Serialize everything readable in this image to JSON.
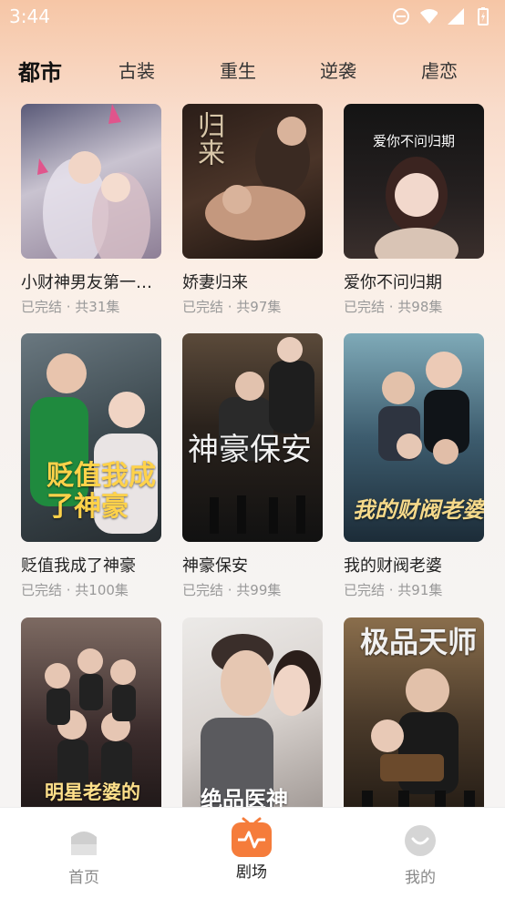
{
  "status": {
    "time": "3:44"
  },
  "tabs": [
    "都市",
    "古装",
    "重生",
    "逆袭",
    "虐恋"
  ],
  "items": [
    {
      "title": "小财神男友第一…",
      "meta": "已完结 · 共31集"
    },
    {
      "title": "娇妻归来",
      "meta": "已完结 · 共97集",
      "poster_text": "归来"
    },
    {
      "title": "爱你不问归期",
      "meta": "已完结 · 共98集",
      "poster_text": "爱你不问归期"
    },
    {
      "title": "贬值我成了神豪",
      "meta": "已完结 · 共100集",
      "poster_text": "贬值我成了神豪"
    },
    {
      "title": "神豪保安",
      "meta": "已完结 · 共99集",
      "poster_text": "神豪保安"
    },
    {
      "title": "我的财阀老婆",
      "meta": "已完结 · 共91集",
      "poster_text": "我的财阀老婆"
    },
    {
      "title": "",
      "meta": "",
      "poster_text": "明星老婆的"
    },
    {
      "title": "",
      "meta": "",
      "poster_text": "绝品医神"
    },
    {
      "title": "",
      "meta": "",
      "poster_text": "极品天师"
    }
  ],
  "nav": [
    {
      "label": "首页",
      "icon": "home-icon"
    },
    {
      "label": "剧场",
      "icon": "theater-icon"
    },
    {
      "label": "我的",
      "icon": "profile-icon"
    }
  ],
  "colors": {
    "accent": "#f57c3b",
    "background": "#f6c6a6"
  }
}
